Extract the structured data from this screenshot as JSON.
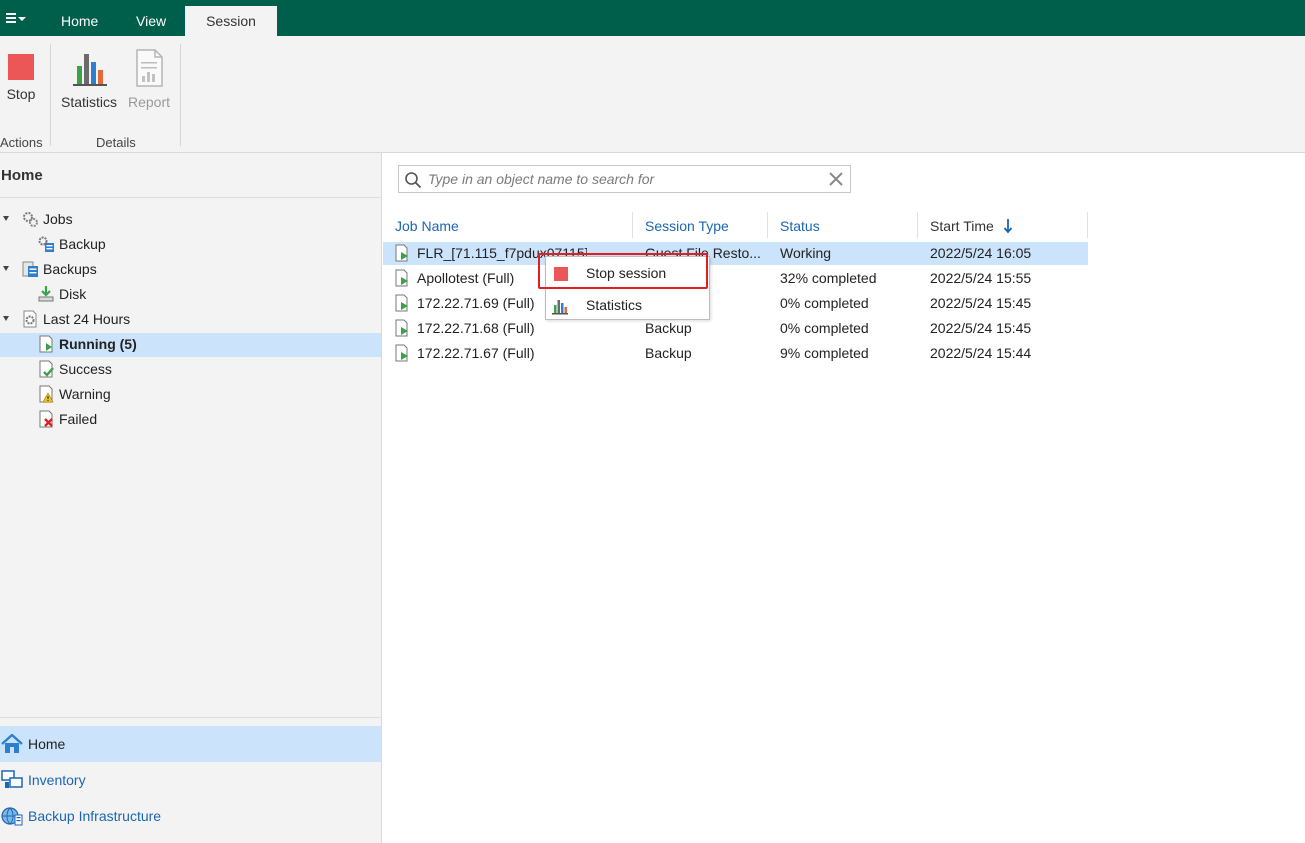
{
  "menubar": {
    "tabs": [
      {
        "label": "Home"
      },
      {
        "label": "View"
      },
      {
        "label": "Session",
        "active": true
      }
    ]
  },
  "ribbon": {
    "stop_label": "Stop",
    "statistics_label": "Statistics",
    "report_label": "Report",
    "group_actions": "Actions",
    "group_details": "Details"
  },
  "sidebar": {
    "title": "Home",
    "tree": [
      {
        "label": "Jobs",
        "icon": "gears-icon"
      },
      {
        "label": "Backup",
        "icon": "backup-job-icon"
      },
      {
        "label": "Backups",
        "icon": "backups-icon"
      },
      {
        "label": "Disk",
        "icon": "disk-icon"
      },
      {
        "label": "Last 24 Hours",
        "icon": "clock-gear-icon"
      },
      {
        "label": "Running (5)",
        "icon": "running-icon",
        "selected": true
      },
      {
        "label": "Success",
        "icon": "success-icon"
      },
      {
        "label": "Warning",
        "icon": "warning-icon"
      },
      {
        "label": "Failed",
        "icon": "failed-icon"
      }
    ],
    "nav": [
      {
        "label": "Home",
        "icon": "house-icon",
        "selected": true
      },
      {
        "label": "Inventory",
        "icon": "inventory-icon"
      },
      {
        "label": "Backup Infrastructure",
        "icon": "globe-server-icon"
      }
    ]
  },
  "search": {
    "placeholder": "Type in an object name to search for"
  },
  "table": {
    "columns": [
      "Job Name",
      "Session Type",
      "Status",
      "Start Time"
    ],
    "rows": [
      {
        "name": "FLR_[71.115_f7pdux07115]",
        "type": "Guest File Resto...",
        "status": "Working",
        "start": "2022/5/24 16:05"
      },
      {
        "name": "Apollotest (Full)",
        "type": "",
        "status": "32% completed",
        "start": "2022/5/24 15:55"
      },
      {
        "name": "172.22.71.69 (Full)",
        "type": "",
        "status": "0% completed",
        "start": "2022/5/24 15:45"
      },
      {
        "name": "172.22.71.68 (Full)",
        "type": "Backup",
        "status": "0% completed",
        "start": "2022/5/24 15:45"
      },
      {
        "name": "172.22.71.67 (Full)",
        "type": "Backup",
        "status": "9% completed",
        "start": "2022/5/24 15:44"
      }
    ]
  },
  "context_menu": {
    "items": [
      {
        "label": "Stop session",
        "icon": "stop-icon"
      },
      {
        "label": "Statistics",
        "icon": "statistics-icon"
      }
    ]
  },
  "colors": {
    "menubar": "#005f4b",
    "selection": "#cce4fb",
    "link_blue": "#1a66b3",
    "stop_red": "#eb5757",
    "highlight_red": "#e02020"
  }
}
